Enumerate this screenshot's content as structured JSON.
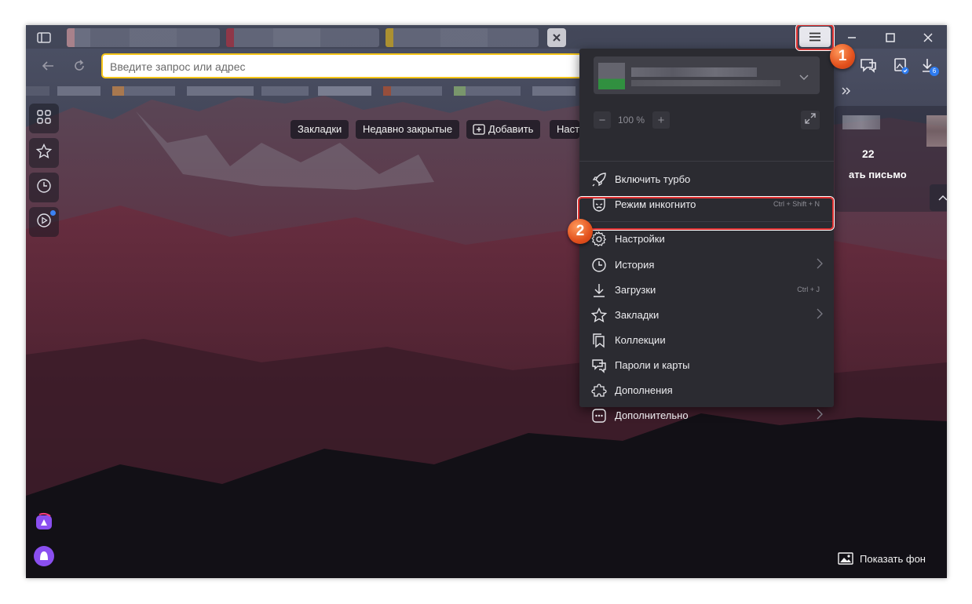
{
  "address_bar": {
    "placeholder": "Введите запрос или адрес"
  },
  "bookmarks_chips": [
    {
      "label": "Закладки"
    },
    {
      "label": "Недавно закрытые"
    },
    {
      "label": "Добавить"
    },
    {
      "label": "Наст"
    }
  ],
  "zoom": {
    "level": "100 %",
    "minus": "−",
    "plus": "+"
  },
  "menu": {
    "items": [
      {
        "label": "Включить турбо",
        "icon": "rocket-icon",
        "shortcut": ""
      },
      {
        "label": "Режим инкогнито",
        "icon": "incognito-mask-icon",
        "shortcut": "Ctrl + Shift + N"
      },
      {
        "label": "Настройки",
        "icon": "gear-icon",
        "shortcut": ""
      },
      {
        "label": "История",
        "icon": "clock-icon",
        "shortcut": ""
      },
      {
        "label": "Загрузки",
        "icon": "download-icon",
        "shortcut": "Ctrl + J"
      },
      {
        "label": "Закладки",
        "icon": "star-icon",
        "shortcut": ""
      },
      {
        "label": "Коллекции",
        "icon": "collections-icon",
        "shortcut": ""
      },
      {
        "label": "Пароли и карты",
        "icon": "key-icon",
        "shortcut": ""
      },
      {
        "label": "Дополнения",
        "icon": "puzzle-icon",
        "shortcut": ""
      },
      {
        "label": "Дополнительно",
        "icon": "more-icon",
        "shortcut": ""
      }
    ]
  },
  "annotations": {
    "step1": "1",
    "step2": "2"
  },
  "widget": {
    "count": "22",
    "text": "ать письмо"
  },
  "downloads_badge": "6",
  "show_background": "Показать фон",
  "colors": {
    "accent_yellow": "#f5c518",
    "highlight_red": "#e03030",
    "badge_orange": "#e2511d",
    "menu_bg": "#2b2b31"
  }
}
